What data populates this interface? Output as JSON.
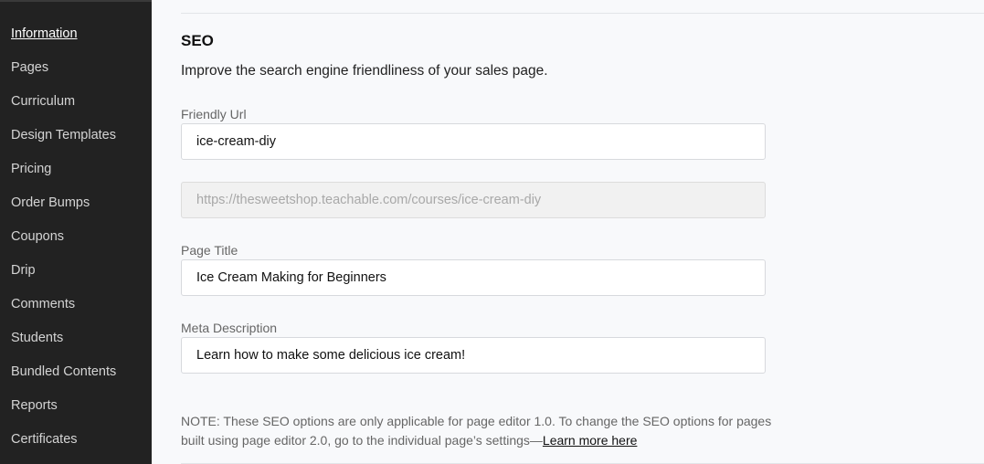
{
  "sidebar": {
    "items": [
      {
        "label": "Information",
        "active": true
      },
      {
        "label": "Pages"
      },
      {
        "label": "Curriculum"
      },
      {
        "label": "Design Templates"
      },
      {
        "label": "Pricing"
      },
      {
        "label": "Order Bumps"
      },
      {
        "label": "Coupons"
      },
      {
        "label": "Drip"
      },
      {
        "label": "Comments"
      },
      {
        "label": "Students"
      },
      {
        "label": "Bundled Contents"
      },
      {
        "label": "Reports"
      },
      {
        "label": "Certificates"
      }
    ]
  },
  "seo": {
    "title": "SEO",
    "description": "Improve the search engine friendliness of your sales page.",
    "friendly_url": {
      "label": "Friendly Url",
      "value": "ice-cream-diy"
    },
    "full_url": {
      "value": "https://thesweetshop.teachable.com/courses/ice-cream-diy"
    },
    "page_title": {
      "label": "Page Title",
      "value": "Ice Cream Making for Beginners"
    },
    "meta_description": {
      "label": "Meta Description",
      "value": "Learn how to make some delicious ice cream!"
    },
    "note": "NOTE: These SEO options are only applicable for page editor 1.0. To change the SEO options for pages built using page editor 2.0, go to the individual page’s settings—",
    "note_link": "Learn more here"
  }
}
